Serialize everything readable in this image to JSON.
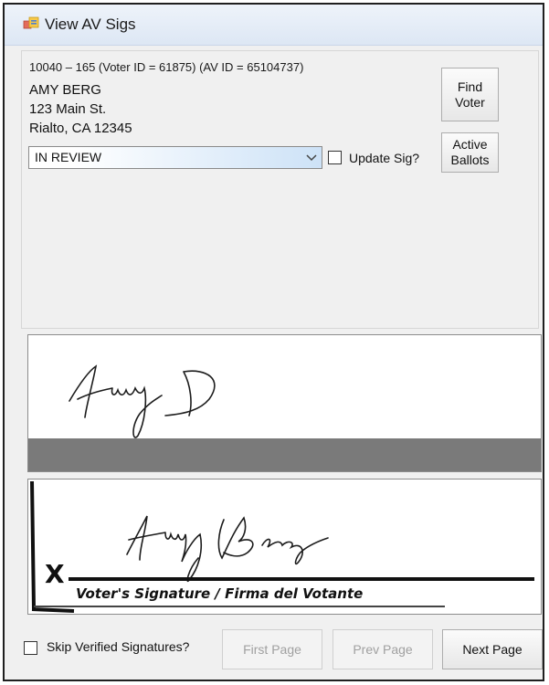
{
  "window": {
    "title": "View AV Sigs"
  },
  "voter": {
    "id_line": "10040 – 165 (Voter ID = 61875) (AV ID = 65104737)",
    "name": "AMY BERG",
    "street": "123 Main St.",
    "city_line": "Rialto, CA 12345"
  },
  "buttons": {
    "find_voter": "Find\nVoter",
    "active_ballots": "Active\nBallots",
    "first_page": "First Page",
    "prev_page": "Prev Page",
    "next_page": "Next Page"
  },
  "status_select": {
    "value": "IN REVIEW"
  },
  "update_sig": {
    "label": "Update Sig?",
    "checked": false
  },
  "skip_verified": {
    "label": "Skip Verified Signatures?",
    "checked": false
  },
  "signature_form": {
    "x_mark": "X",
    "caption": "Voter's Signature / Firma del Votante"
  },
  "colors": {
    "title_bar": "#e4ecf7",
    "select_highlight": "#cde2f7",
    "signature_band": "#7a7a7a"
  }
}
